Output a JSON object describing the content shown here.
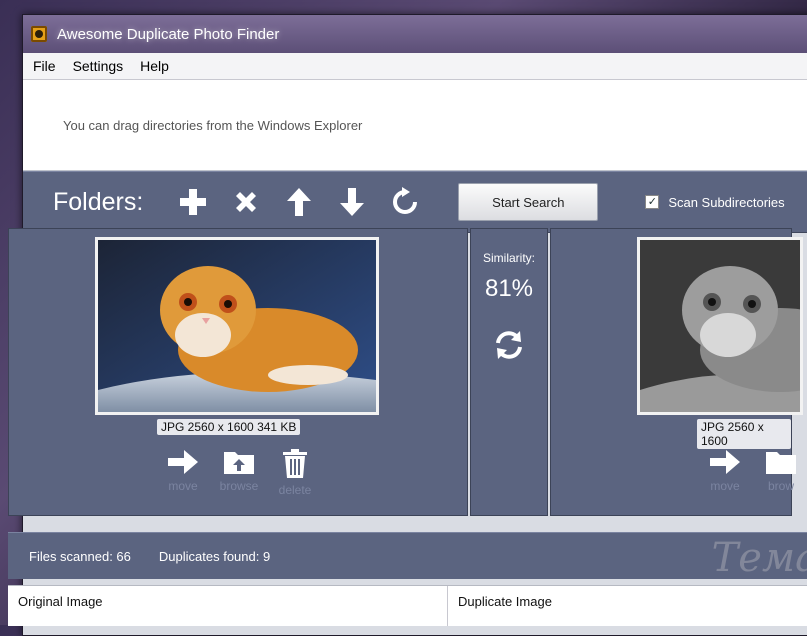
{
  "window": {
    "title": "Awesome Duplicate Photo Finder"
  },
  "menu": [
    "File",
    "Settings",
    "Help"
  ],
  "dropzone": {
    "hint": "You can drag directories from the Windows Explorer"
  },
  "toolbar": {
    "folders_label": "Folders:",
    "icons": [
      "plus-icon",
      "x-icon",
      "arrow-up-icon",
      "arrow-down-icon",
      "refresh-icon"
    ],
    "start_button": "Start Search",
    "scan_subdirs_label": "Scan Subdirectories",
    "scan_subdirs_checked": true
  },
  "original": {
    "info": "JPG  2560 x 1600  341 KB",
    "actions": [
      "move",
      "browse",
      "delete"
    ]
  },
  "similarity": {
    "label": "Similarity:",
    "value": "81%"
  },
  "duplicate": {
    "info": "JPG  2560 x 1600",
    "actions": [
      "move",
      "brow"
    ]
  },
  "status": {
    "files_scanned": "Files scanned: 66",
    "duplicates_found": "Duplicates found: 9",
    "watermark": "Тема"
  },
  "table": {
    "headers": [
      "Original Image",
      "Duplicate Image"
    ]
  },
  "colors": {
    "panel": "#5b6480",
    "accent_cat": "#d98a2a"
  }
}
